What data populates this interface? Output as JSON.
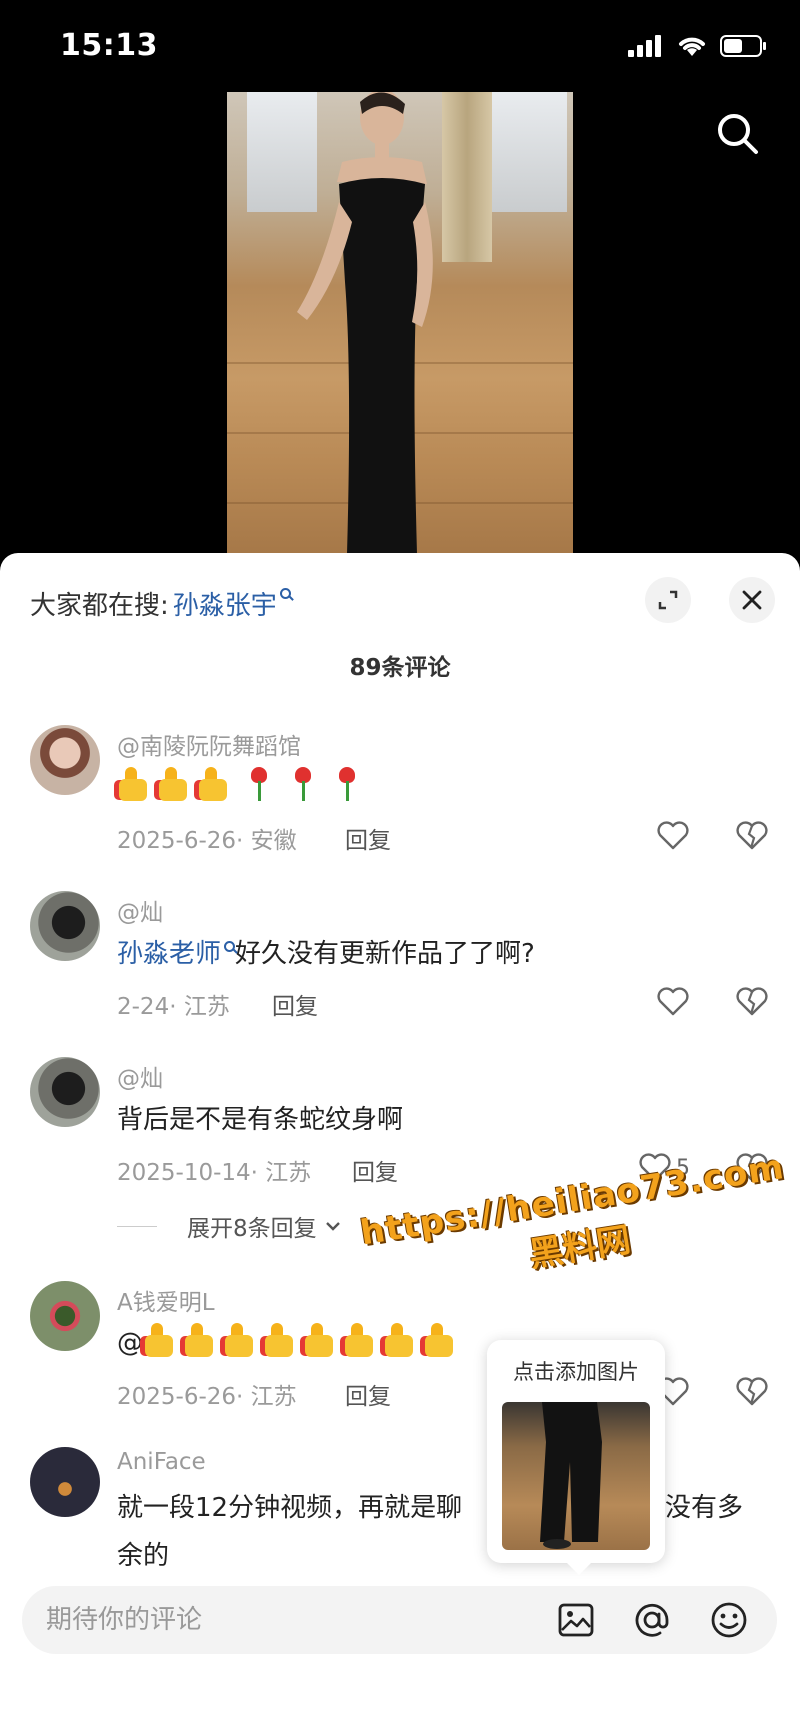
{
  "status_bar": {
    "time": "15:13"
  },
  "sheet": {
    "trending_prefix": "大家都在搜:",
    "trending_keyword": "孙淼张宇",
    "comment_count": "89条评论"
  },
  "comments": [
    {
      "name": "@南陵阮阮舞蹈馆",
      "emoji_thumbs": 3,
      "emoji_roses": 3,
      "date": "2025-6-26· 安徽",
      "reply": "回复",
      "likes": ""
    },
    {
      "name": "@灿",
      "mention": "孙淼老师",
      "text": "好久没有更新作品了了啊?",
      "date": "2-24· 江苏",
      "reply": "回复",
      "likes": ""
    },
    {
      "name": "@灿",
      "text": "背后是不是有条蛇纹身啊",
      "date": "2025-10-14· 江苏",
      "reply": "回复",
      "likes": "5",
      "expand": "展开8条回复"
    },
    {
      "name": "A钱爱明L",
      "prefix": "@",
      "emoji_thumbs": 8,
      "date": "2025-6-26· 江苏",
      "reply": "回复",
      "likes": ""
    },
    {
      "name": "AniFace",
      "text_part1": "就一段12分钟视频，再就是聊",
      "text_part2": "没有多",
      "text_part3": "余的"
    }
  ],
  "popup": {
    "label": "点击添加图片"
  },
  "input": {
    "placeholder": "期待你的评论"
  },
  "watermark": {
    "line1": "https://heiliao73.com",
    "line2": "黑料网"
  },
  "icons": [
    "signal-icon",
    "wifi-icon",
    "battery-icon",
    "search-icon",
    "expand-icon",
    "close-icon",
    "heart-icon",
    "heart-broken-icon",
    "chevron-down-icon",
    "image-icon",
    "at-icon",
    "emoji-icon"
  ],
  "colors": {
    "mention": "#2b5fa6",
    "watermark": "#f3a21c"
  }
}
